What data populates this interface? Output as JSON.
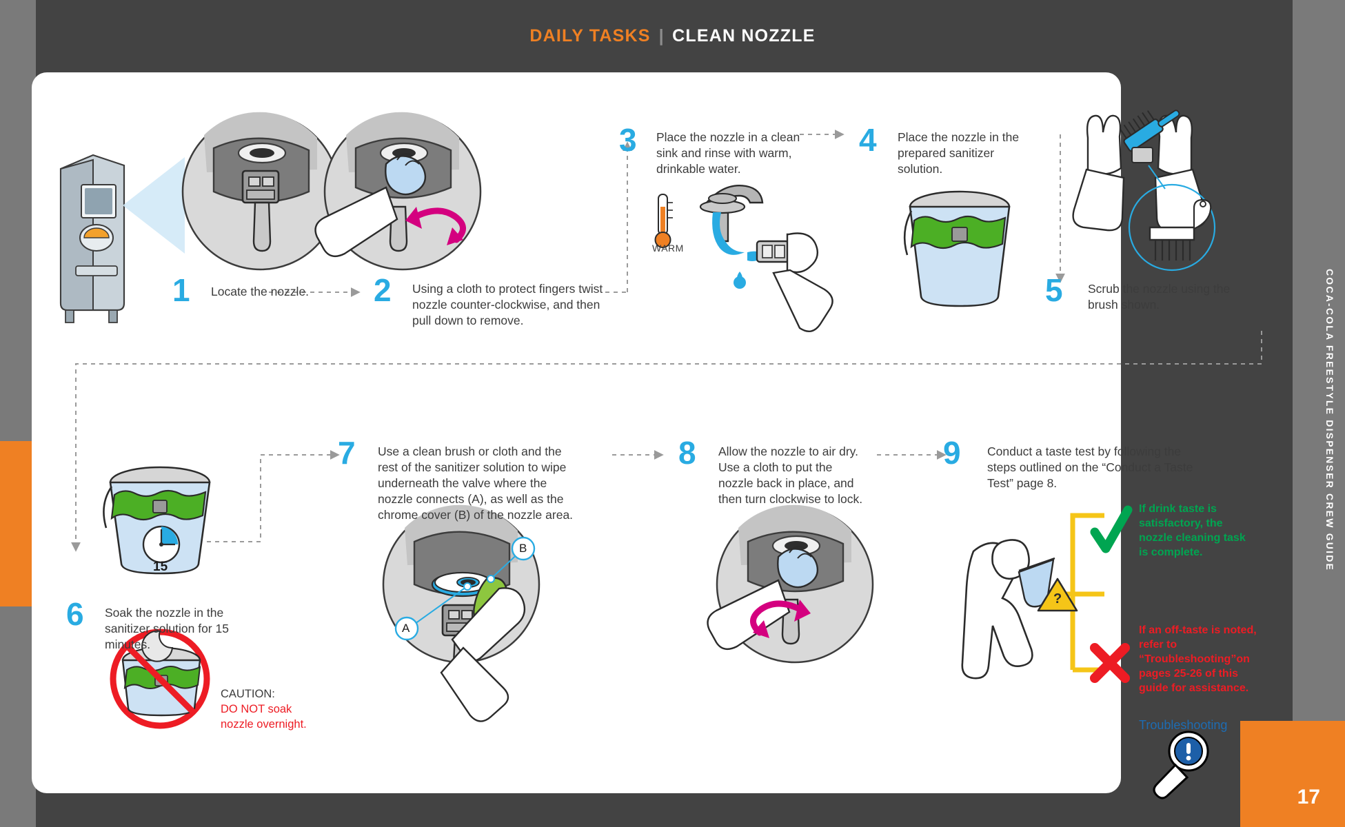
{
  "header": {
    "category": "DAILY TASKS",
    "separator": "|",
    "title": "CLEAN NOZZLE"
  },
  "sidebar": {
    "guide_title": "COCA-COLA FREESTYLE DISPENSER CREW GUIDE",
    "page_number": "17"
  },
  "colors": {
    "accent_orange": "#ef8023",
    "step_blue": "#29abe2",
    "text_dark": "#3c3c3c",
    "success_green": "#00a551",
    "error_red": "#ed1c24",
    "link_blue": "#1d6cb3",
    "magenta_arrow": "#d4007f",
    "yellow_bracket": "#f5c518"
  },
  "steps": [
    {
      "number": "1",
      "text": "Locate the nozzle."
    },
    {
      "number": "2",
      "text": "Using a cloth to protect fingers twist nozzle counter-clockwise, and then pull down to remove."
    },
    {
      "number": "3",
      "text": "Place the nozzle in a clean sink and rinse with warm, drinkable water."
    },
    {
      "number": "4",
      "text": "Place the nozzle in the prepared sanitizer solution."
    },
    {
      "number": "5",
      "text": "Scrub the nozzle using the brush shown."
    },
    {
      "number": "6",
      "text": "Soak the nozzle in the sanitizer solution for 15 minutes."
    },
    {
      "number": "7",
      "text": "Use a clean brush or cloth and the rest of the sanitizer solution to wipe underneath the valve where the nozzle connects (A), as well as the chrome cover (B) of the nozzle area."
    },
    {
      "number": "8",
      "text": "Allow the nozzle to air dry. Use a cloth to put the nozzle back in place, and then turn clockwise to lock."
    },
    {
      "number": "9",
      "text": "Conduct a taste test by following the steps outlined on the “Conduct a Taste Test” page 8."
    }
  ],
  "labels": {
    "warm": "WARM",
    "timer_minutes": "15",
    "callout_a": "A",
    "callout_b": "B",
    "question_mark": "?"
  },
  "caution": {
    "heading": "CAUTION:",
    "line1": "DO NOT soak",
    "line2": "nozzle overnight."
  },
  "outcomes": {
    "success": "If drink taste is satisfactory, the nozzle cleaning task is complete.",
    "failure": "If an off-taste is noted, refer to “Troubleshooting”on pages 25-26 of this guide for assistance.",
    "troubleshooting_link": "Troubleshooting"
  }
}
